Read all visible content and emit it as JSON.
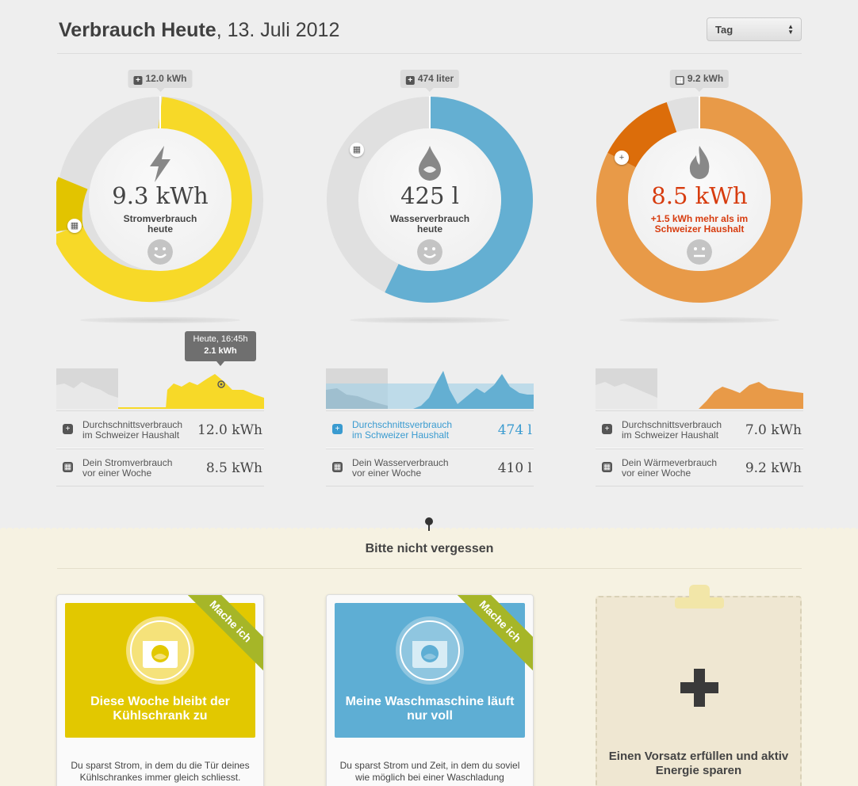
{
  "header": {
    "title_bold": "Verbrauch Heute",
    "title_date": ", 13. Juli 2012",
    "period_select": "Tag"
  },
  "meters": [
    {
      "tag": "12.0 kWh",
      "value": "9.3 kWh",
      "label_line1": "Stromverbrauch",
      "label_line2": "heute",
      "icon": "lightning-icon",
      "mood": "happy-face-icon",
      "color_main": "#f5d81c",
      "color_secondary": "#e2c400",
      "stats": [
        {
          "line1": "Durchschnittsverbrauch",
          "line2": "im Schweizer Haushalt",
          "value": "12.0 kWh"
        },
        {
          "line1": "Dein Stromverbrauch",
          "line2": "vor einer Woche",
          "value": "8.5 kWh"
        }
      ]
    },
    {
      "tag": "474 liter",
      "value": "425 l",
      "label_line1": "Wasserverbrauch",
      "label_line2": "heute",
      "icon": "water-drop-icon",
      "mood": "happy-face-icon",
      "color_main": "#64afd2",
      "stats": [
        {
          "line1": "Durchschnittsverbrauch",
          "line2": "im Schweizer Haushalt",
          "value": "474 l"
        },
        {
          "line1": "Dein Wasserverbrauch",
          "line2": "vor einer Woche",
          "value": "410 l"
        }
      ]
    },
    {
      "tag": "9.2 kWh",
      "value": "8.5 kWh",
      "label_line1": "+1.5 kWh mehr als im",
      "label_line2": "Schweizer Haushalt",
      "icon": "flame-icon",
      "mood": "neutral-face-icon",
      "color_main": "#e89a48",
      "color_secondary": "#dc6d0a",
      "stats": [
        {
          "line1": "Durchschnittsverbrauch",
          "line2": "im Schweizer Haushalt",
          "value": "7.0 kWh"
        },
        {
          "line1": "Dein Wärmeverbrauch",
          "line2": "vor einer Woche",
          "value": "9.2 kWh"
        }
      ]
    }
  ],
  "tooltip": {
    "time": "Heute, 16:45h",
    "value": "2.1 kWh"
  },
  "reminders": {
    "heading": "Bitte nicht vergessen",
    "cards": [
      {
        "title": "Diese Woche bleibt der Kühlschrank zu",
        "ribbon": "Mache ich",
        "desc": "Du sparst Strom, in dem du die Tür deines Kühlschrankes immer gleich schliesst."
      },
      {
        "title": "Meine Waschmaschine läuft nur voll",
        "ribbon": "Mache ich",
        "desc": "Du sparst Strom und Zeit, in dem du soviel wie möglich bei einer Waschladung"
      }
    ],
    "add_card": "Einen Vorsatz erfüllen und aktiv Energie sparen"
  }
}
